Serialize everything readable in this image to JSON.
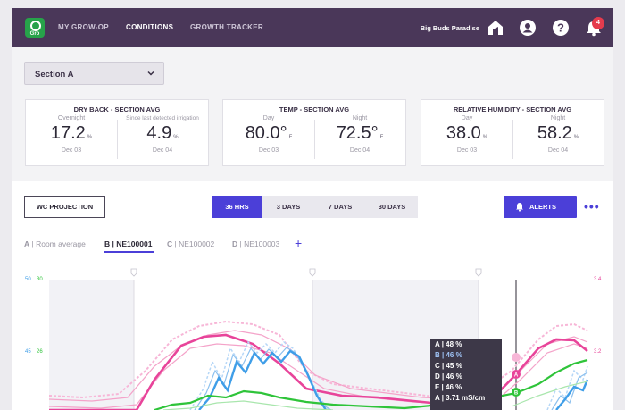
{
  "nav": {
    "logo_text": "Gro",
    "items": [
      {
        "label": "MY GROW-OP",
        "active": false
      },
      {
        "label": "CONDITIONS",
        "active": true
      },
      {
        "label": "GROWTH TRACKER",
        "active": false
      }
    ],
    "brand": "Big Buds Paradise",
    "notification_count": "4",
    "icons": [
      "house-icon",
      "user-icon",
      "help-icon",
      "bell-icon"
    ]
  },
  "section_select": {
    "value": "Section A"
  },
  "cards": [
    {
      "title": "DRY BACK - SECTION AVG",
      "left": {
        "sub": "Overnight",
        "value": "17.2",
        "unit": "%",
        "date": "Dec 03"
      },
      "right": {
        "sub": "Since last detected irrigation",
        "value": "4.9",
        "unit": "%",
        "date": "Dec 04"
      }
    },
    {
      "title": "TEMP - SECTION AVG",
      "left": {
        "sub": "Day",
        "value": "80.0°",
        "unit": "F",
        "date": "Dec 03"
      },
      "right": {
        "sub": "Night",
        "value": "72.5°",
        "unit": "F",
        "date": "Dec 04"
      }
    },
    {
      "title": "RELATIVE HUMIDITY - SECTION AVG",
      "left": {
        "sub": "Day",
        "value": "38.0",
        "unit": "%",
        "date": "Dec 03"
      },
      "right": {
        "sub": "Night",
        "value": "58.2",
        "unit": "%",
        "date": "Dec 04"
      }
    }
  ],
  "controls": {
    "wc_projection": "WC PROJECTION",
    "ranges": [
      "36 HRS",
      "3 DAYS",
      "7 DAYS",
      "30 DAYS"
    ],
    "active_range": "36 HRS",
    "alerts": "ALERTS"
  },
  "tabs": [
    {
      "letter": "A",
      "label": "Room average"
    },
    {
      "letter": "B",
      "label": "NE100001"
    },
    {
      "letter": "C",
      "label": "NE100002"
    },
    {
      "letter": "D",
      "label": "NE100003"
    }
  ],
  "axis": {
    "left1": [
      "50",
      "45"
    ],
    "left2": [
      "30",
      "26"
    ],
    "right": [
      "3.4",
      "3.2"
    ]
  },
  "colors": {
    "accent": "#4b3fd8",
    "header": "#4a3759",
    "pink": "#e8449a",
    "blue": "#3f9ee8",
    "green": "#2fc43a"
  },
  "tooltip": [
    "A | 48 %",
    "B | 46 %",
    "C | 45 %",
    "D | 46 %",
    "E | 46 %",
    "A | 3.71 mS/cm"
  ]
}
